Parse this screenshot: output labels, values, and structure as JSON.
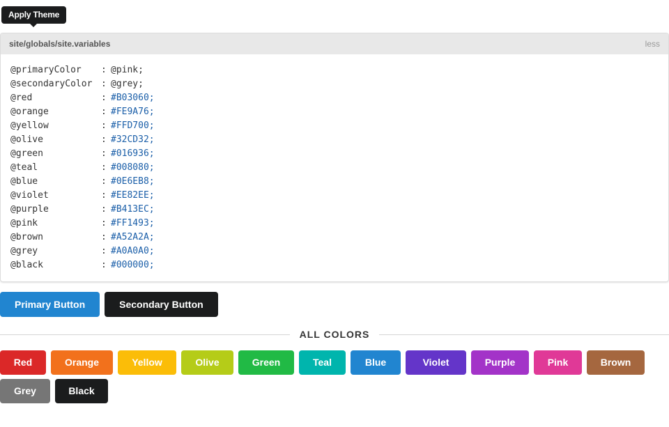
{
  "tooltip_button": {
    "label": "Apply Theme"
  },
  "code_panel": {
    "path": "site/globals/site.variables",
    "language": "less",
    "lines": [
      {
        "name": "@primaryColor",
        "value": "@pink;",
        "hex": false
      },
      {
        "name": "@secondaryColor",
        "value": "@grey;",
        "hex": false
      },
      {
        "name": "@red",
        "value": "#B03060;",
        "hex": true
      },
      {
        "name": "@orange",
        "value": "#FE9A76;",
        "hex": true
      },
      {
        "name": "@yellow",
        "value": "#FFD700;",
        "hex": true
      },
      {
        "name": "@olive",
        "value": "#32CD32;",
        "hex": true
      },
      {
        "name": "@green",
        "value": "#016936;",
        "hex": true
      },
      {
        "name": "@teal",
        "value": "#008080;",
        "hex": true
      },
      {
        "name": "@blue",
        "value": "#0E6EB8;",
        "hex": true
      },
      {
        "name": "@violet",
        "value": "#EE82EE;",
        "hex": true
      },
      {
        "name": "@purple",
        "value": "#B413EC;",
        "hex": true
      },
      {
        "name": "@pink",
        "value": "#FF1493;",
        "hex": true
      },
      {
        "name": "@brown",
        "value": "#A52A2A;",
        "hex": true
      },
      {
        "name": "@grey",
        "value": "#A0A0A0;",
        "hex": true
      },
      {
        "name": "@black",
        "value": "#000000;",
        "hex": true
      }
    ]
  },
  "buttons": {
    "primary": {
      "label": "Primary Button",
      "color": "#2185d0"
    },
    "secondary": {
      "label": "Secondary Button",
      "color": "#1b1c1d"
    }
  },
  "divider": {
    "label": "ALL COLORS"
  },
  "colors": [
    [
      {
        "label": "Red",
        "color": "#db2828"
      },
      {
        "label": "Orange",
        "color": "#f2711c"
      },
      {
        "label": "Yellow",
        "color": "#fbbd08"
      },
      {
        "label": "Olive",
        "color": "#b5cc18"
      },
      {
        "label": "Green",
        "color": "#21ba45"
      },
      {
        "label": "Teal",
        "color": "#00b5ad"
      },
      {
        "label": "Blue",
        "color": "#2185d0"
      },
      {
        "label": "Violet",
        "color": "#6435c9"
      },
      {
        "label": "Purple",
        "color": "#a333c8"
      },
      {
        "label": "Pink",
        "color": "#e03997"
      },
      {
        "label": "Brown",
        "color": "#a5673f"
      }
    ],
    [
      {
        "label": "Grey",
        "color": "#767676"
      },
      {
        "label": "Black",
        "color": "#1b1c1d"
      }
    ]
  ]
}
